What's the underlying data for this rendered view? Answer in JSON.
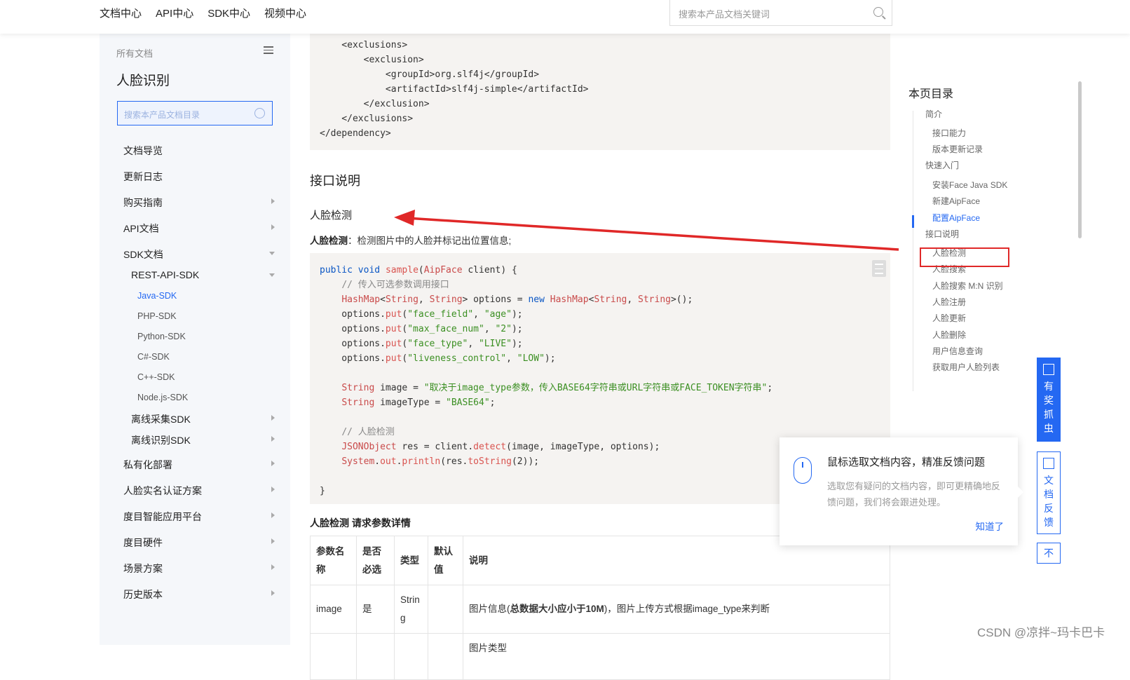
{
  "topnav": [
    "文档中心",
    "API中心",
    "SDK中心",
    "视频中心"
  ],
  "top_search": {
    "placeholder": "搜索本产品文档关键词"
  },
  "sidebar": {
    "head": "所有文档",
    "title": "人脸识别",
    "search_placeholder": "搜索本产品文档目录",
    "items": [
      "文档导览",
      "更新日志",
      "购买指南",
      "API文档",
      "SDK文档"
    ],
    "sub1": "REST-API-SDK",
    "subsub": [
      "Java-SDK",
      "PHP-SDK",
      "Python-SDK",
      "C#-SDK",
      "C++-SDK",
      "Node.js-SDK"
    ],
    "sub2": [
      "离线采集SDK",
      "离线识别SDK"
    ],
    "items2": [
      "私有化部署",
      "人脸实名认证方案",
      "度目智能应用平台",
      "度目硬件",
      "场景方案",
      "历史版本"
    ]
  },
  "code_top": {
    "lines": [
      "    <exclusions>",
      "        <exclusion>",
      "            <groupId>org.slf4j</groupId>",
      "            <artifactId>slf4j-simple</artifactId>",
      "        </exclusion>",
      "    </exclusions>",
      "</dependency>"
    ]
  },
  "content": {
    "h2": "接口说明",
    "h3": "人脸检测",
    "desc_label": "人脸检测",
    "desc_text": "：检测图片中的人脸并标记出位置信息;",
    "params_title": "人脸检测 请求参数详情",
    "table_headers": [
      "参数名称",
      "是否必选",
      "类型",
      "默认值",
      "说明"
    ],
    "table_row": {
      "name": "image",
      "required": "是",
      "type": "String",
      "default": "",
      "desc_pre": "图片信息(",
      "desc_bold": "总数据大小应小于10M",
      "desc_post": ")，图片上传方式根据image_type来判断"
    },
    "table_row2_partial": "图片类型"
  },
  "toc": {
    "title": "本页目录",
    "items": [
      "简介",
      "接口能力",
      "版本更新记录",
      "快速入门",
      "安装Face Java SDK",
      "新建AipFace",
      "配置AipFace",
      "接口说明",
      "人脸检测",
      "人脸搜索",
      "人脸搜索 M:N 识别",
      "人脸注册",
      "人脸更新",
      "人脸删除",
      "用户信息查询",
      "获取用户人脸列表"
    ]
  },
  "side_buttons": {
    "bug_bounty": "有奖抓虫",
    "feedback": "文档反馈",
    "top": "不"
  },
  "popup": {
    "title": "鼠标选取文档内容，精准反馈问题",
    "text": "选取您有疑问的文档内容，即可更精确地反馈问题，我们将会跟进处理。",
    "ok": "知道了"
  },
  "watermark": "CSDN @凉拌~玛卡巴卡",
  "colors": {
    "accent": "#2468f2",
    "annotation_red": "#e02828"
  }
}
